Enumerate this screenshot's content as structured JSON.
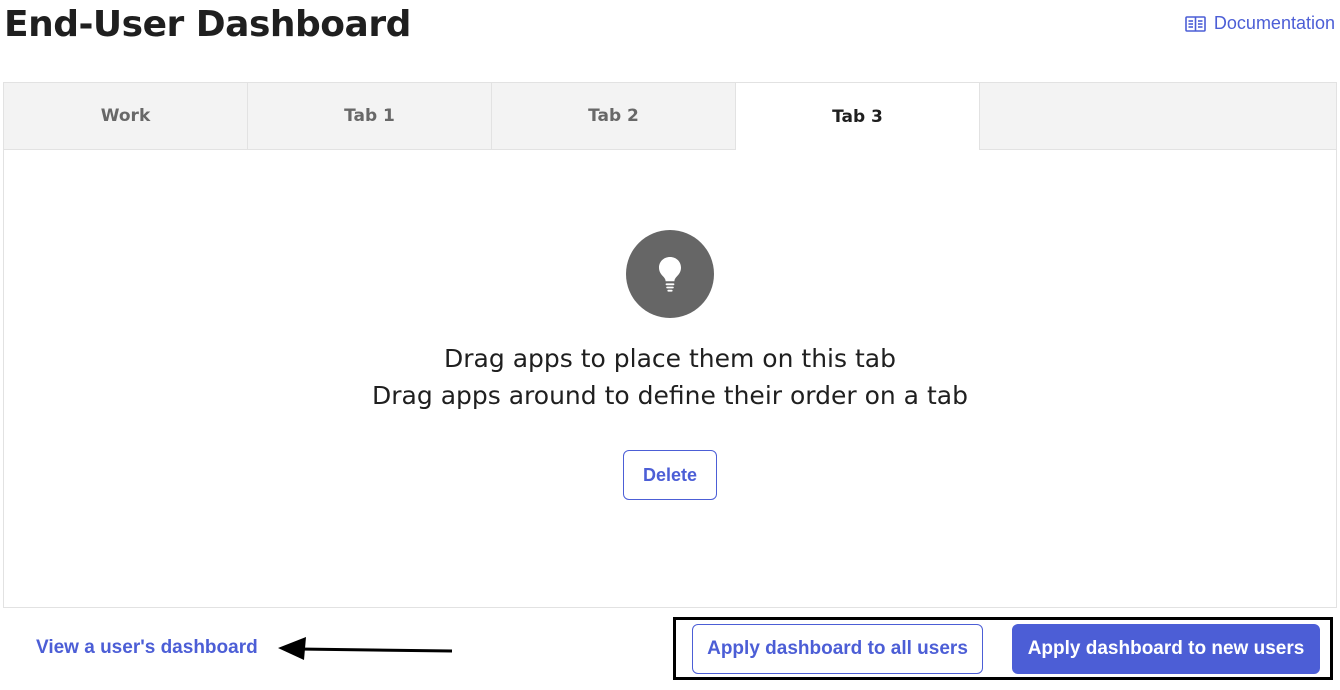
{
  "header": {
    "title": "End-User Dashboard",
    "documentation_label": "Documentation",
    "documentation_icon": "book-icon"
  },
  "tabs": [
    {
      "label": "Work",
      "active": false
    },
    {
      "label": "Tab 1",
      "active": false
    },
    {
      "label": "Tab 2",
      "active": false
    },
    {
      "label": "Tab 3",
      "active": true
    }
  ],
  "empty_state": {
    "icon": "lightbulb-icon",
    "line1": "Drag apps to place them on this tab",
    "line2": "Drag apps around to define their order on a tab",
    "delete_label": "Delete"
  },
  "footer": {
    "view_user_label": "View a user's dashboard",
    "annotation_icon": "arrow-left-icon",
    "apply_all_label": "Apply dashboard to all users",
    "apply_new_label": "Apply dashboard to new users"
  },
  "colors": {
    "accent": "#4c5ed6",
    "tab_bar_bg": "#f3f3f3",
    "icon_circle": "#666666",
    "annotation": "#000000"
  }
}
